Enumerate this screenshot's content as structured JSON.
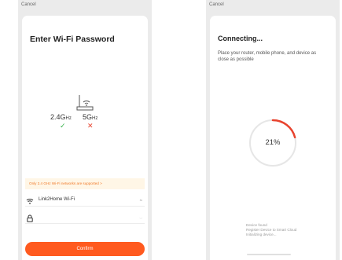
{
  "left": {
    "cancel": "Cancel",
    "title": "Enter Wi-Fi Password",
    "band_24_main": "2.4G",
    "band_24_unit": "Hz",
    "band_5_main": "5G",
    "band_5_unit": "Hz",
    "band_24_supported": true,
    "band_5_supported": false,
    "notice": "Only 2.4 GHz Wi-Fi networks are supported >",
    "ssid": "Link2Home Wi-Fi",
    "ssid_switch": "⇆",
    "password_value": "",
    "password_toggle": "◡",
    "confirm": "Confirm",
    "colors": {
      "accent": "#ff5a1f",
      "ok": "#35b24a",
      "bad": "#e8432e",
      "notice_bg": "#fff6e6",
      "notice_text": "#f07a2a"
    },
    "icons": {
      "router": "router-icon",
      "check": "checkmark-icon",
      "cross": "cross-icon",
      "wifi": "wifi-icon",
      "lock": "lock-icon"
    }
  },
  "right": {
    "cancel": "Cancel",
    "title": "Connecting...",
    "description": "Place your router, mobile phone, and device as close as possible",
    "progress_percent": 21,
    "progress_label": "21%",
    "steps": [
      "Device found",
      "Register Device to Smart Cloud",
      "Initializing device..."
    ],
    "colors": {
      "progress": "#e8432e",
      "track": "#e6e6e6"
    }
  }
}
